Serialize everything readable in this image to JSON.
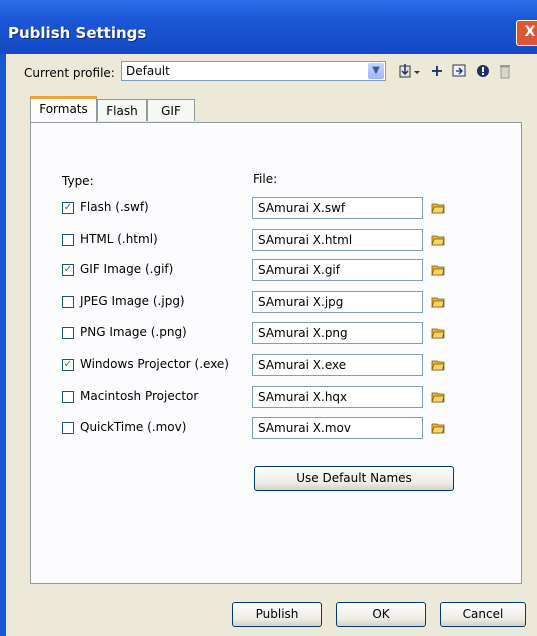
{
  "window": {
    "title": "Publish Settings",
    "close_glyph": "X"
  },
  "profile": {
    "label": "Current profile:",
    "value": "Default",
    "toolbar_icons": [
      "import-export-icon",
      "add-profile-icon",
      "duplicate-profile-icon",
      "profile-settings-icon",
      "delete-profile-icon"
    ]
  },
  "tabs": [
    {
      "label": "Formats",
      "active": true
    },
    {
      "label": "Flash",
      "active": false
    },
    {
      "label": "GIF",
      "active": false
    }
  ],
  "formats": {
    "type_header": "Type:",
    "file_header": "File:",
    "rows": [
      {
        "label": "Flash  (.swf)",
        "checked": true,
        "file": "SAmurai X.swf"
      },
      {
        "label": "HTML  (.html)",
        "checked": false,
        "file": "SAmurai X.html"
      },
      {
        "label": "GIF Image  (.gif)",
        "checked": true,
        "file": "SAmurai X.gif"
      },
      {
        "label": "JPEG Image  (.jpg)",
        "checked": false,
        "file": "SAmurai X.jpg"
      },
      {
        "label": "PNG Image  (.png)",
        "checked": false,
        "file": "SAmurai X.png"
      },
      {
        "label": "Windows Projector  (.exe)",
        "checked": true,
        "file": "SAmurai X.exe"
      },
      {
        "label": "Macintosh Projector",
        "checked": false,
        "file": "SAmurai X.hqx"
      },
      {
        "label": "QuickTime  (.mov)",
        "checked": false,
        "file": "SAmurai X.mov"
      }
    ],
    "default_names_label": "Use Default Names"
  },
  "buttons": {
    "publish": "Publish",
    "ok": "OK",
    "cancel": "Cancel"
  },
  "colors": {
    "title_bar": "#1b56d3",
    "tab_highlight": "#f1a23a",
    "folder": "#e8b830"
  }
}
